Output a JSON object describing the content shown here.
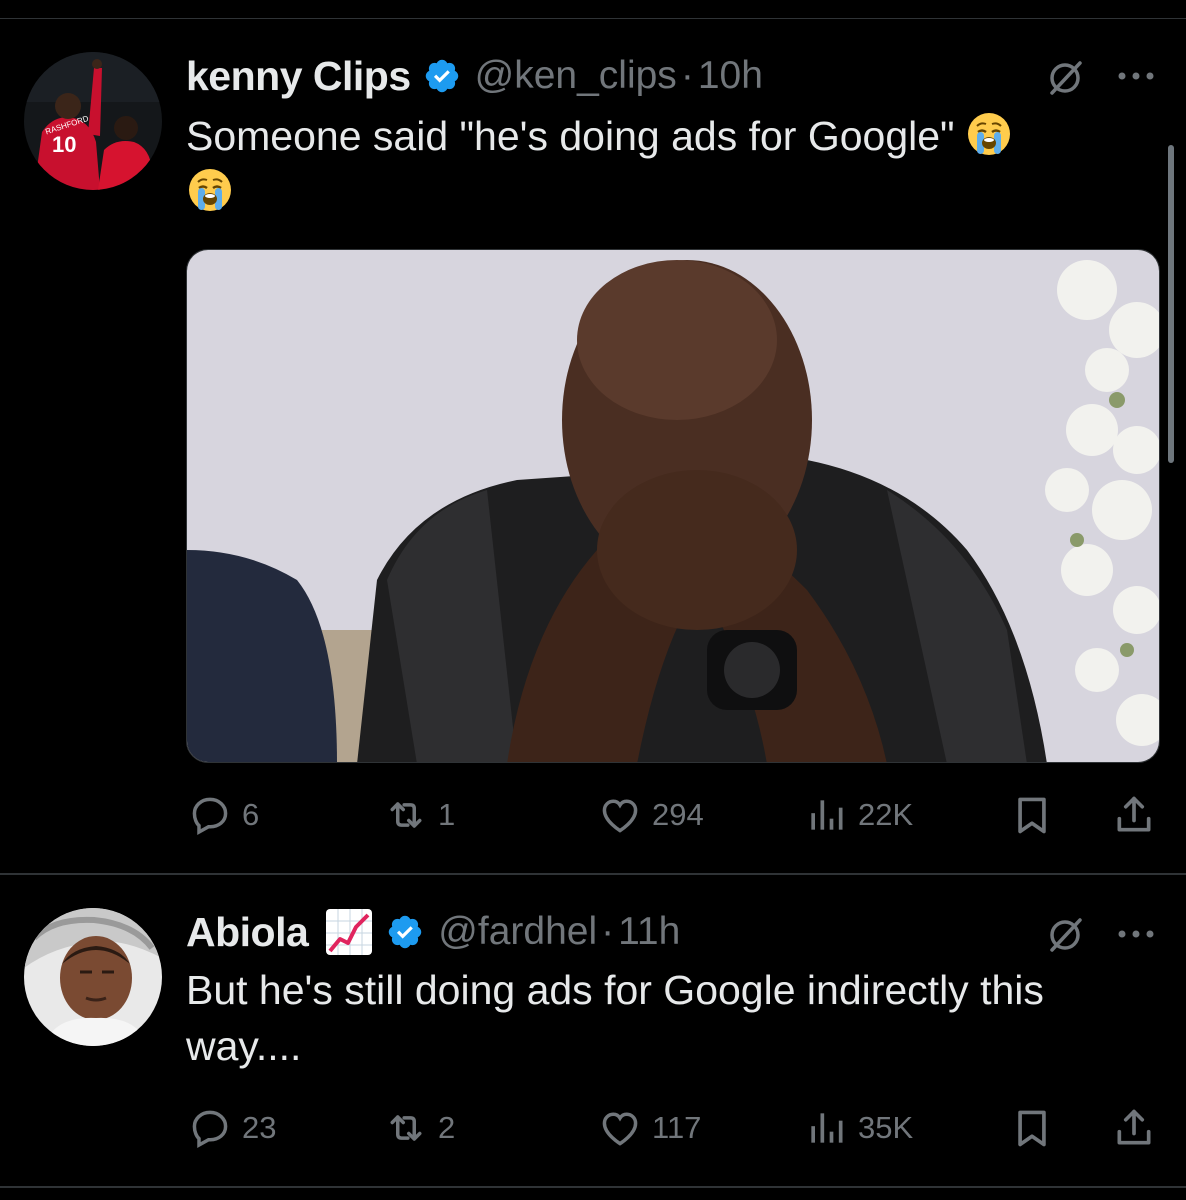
{
  "tweets": [
    {
      "name": "kenny Clips",
      "handle": "@ken_clips",
      "separator": "·",
      "time": "10h",
      "text": "Someone said \"he's doing ads for Google\"",
      "stats": {
        "replies": "6",
        "retweets": "1",
        "likes": "294",
        "views": "22K"
      }
    },
    {
      "name": "Abiola",
      "handle": "@fardhel",
      "separator": "·",
      "time": "11h",
      "text": "But he's still doing ads for Google indirectly this way....",
      "stats": {
        "replies": "23",
        "retweets": "2",
        "likes": "117",
        "views": "35K"
      }
    }
  ],
  "icons": {
    "verified": "verified-badge-icon",
    "grok": "grok-icon",
    "more": "more-icon",
    "reply": "reply-icon",
    "retweet": "retweet-icon",
    "like": "heart-icon",
    "views": "views-icon",
    "bookmark": "bookmark-icon",
    "share": "share-icon",
    "emoji_crying": "loudly-crying-face",
    "emoji_chart": "chart-increasing"
  },
  "colors": {
    "background": "#000000",
    "text": "#e7e9ea",
    "muted": "#71767b",
    "verified": "#1d9bf0",
    "divider": "#2f3336"
  }
}
